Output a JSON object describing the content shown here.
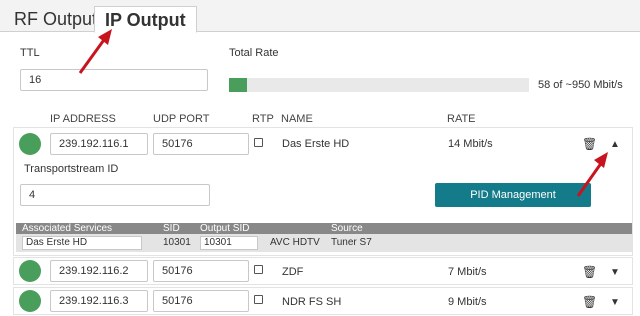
{
  "tabs": [
    {
      "label": "RF Output"
    },
    {
      "label": "IP Output"
    }
  ],
  "ttl": {
    "label": "TTL",
    "value": "16"
  },
  "total_rate": {
    "label": "Total Rate",
    "text": "58 of ~950 Mbit/s",
    "fill_fraction": 0.061
  },
  "columns": {
    "ip": "IP ADDRESS",
    "port": "UDP PORT",
    "rtp": "RTP",
    "name": "NAME",
    "rate": "RATE"
  },
  "rows": [
    {
      "ip": "239.192.116.1",
      "port": "50176",
      "name": "Das Erste HD",
      "rate": "14 Mbit/s",
      "expanded": true
    },
    {
      "ip": "239.192.116.2",
      "port": "50176",
      "name": "ZDF",
      "rate": "7 Mbit/s",
      "expanded": false
    },
    {
      "ip": "239.192.116.3",
      "port": "50176",
      "name": "NDR FS SH",
      "rate": "9 Mbit/s",
      "expanded": false
    }
  ],
  "expanded": {
    "ts_label": "Transportstream ID",
    "ts_value": "4",
    "pid_button": "PID Management"
  },
  "services": {
    "headers": {
      "assoc": "Associated Services",
      "sid": "SID",
      "out_sid": "Output SID",
      "source": "Source"
    },
    "row": {
      "name": "Das Erste HD",
      "sid": "10301",
      "out_sid": "10301",
      "type": "AVC HDTV",
      "source": "Tuner S7"
    }
  },
  "colors": {
    "green": "#4a9e5b",
    "teal": "#137b8a",
    "annotation_red": "#c8141e"
  }
}
